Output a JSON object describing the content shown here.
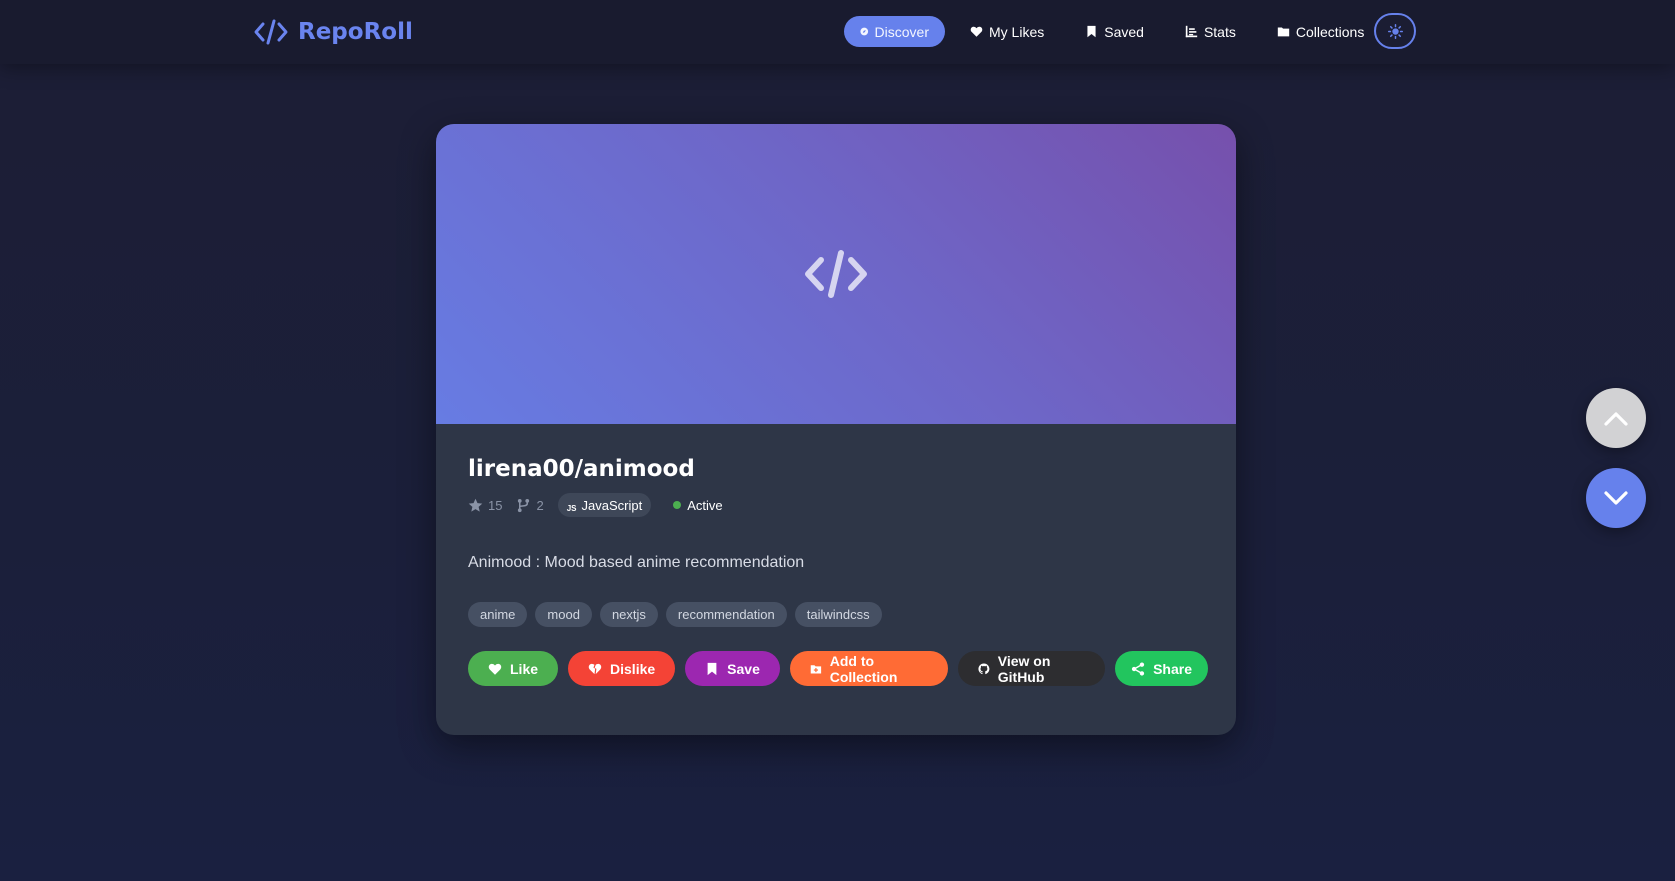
{
  "app": {
    "name": "RepoRoll",
    "logo_icon": "code-icon"
  },
  "nav": {
    "items": [
      {
        "label": "Discover",
        "icon": "compass-icon",
        "active": true
      },
      {
        "label": "My Likes",
        "icon": "heart-icon",
        "active": false
      },
      {
        "label": "Saved",
        "icon": "bookmark-icon",
        "active": false
      },
      {
        "label": "Stats",
        "icon": "chart-icon",
        "active": false
      },
      {
        "label": "Collections",
        "icon": "folder-icon",
        "active": false
      }
    ],
    "theme_toggle_icon": "sun-icon"
  },
  "repo": {
    "full_name": "lirena00/animood",
    "stars": "15",
    "forks": "2",
    "language_icon": "JS",
    "language": "JavaScript",
    "status": "Active",
    "description": "Animood : Mood based anime recommendation",
    "topics": [
      "anime",
      "mood",
      "nextjs",
      "recommendation",
      "tailwindcss"
    ]
  },
  "actions": {
    "like": "Like",
    "dislike": "Dislike",
    "save": "Save",
    "add_to_collection": "Add to Collection",
    "view_on_github": "View on GitHub",
    "share": "Share"
  },
  "colors": {
    "accent": "#6681ec",
    "like": "#4caf50",
    "dislike": "#f44336",
    "save": "#9c27b0",
    "collection": "#ff6b35",
    "github": "#2d2d30",
    "share": "#22c55e",
    "status_active": "#4caf50"
  }
}
